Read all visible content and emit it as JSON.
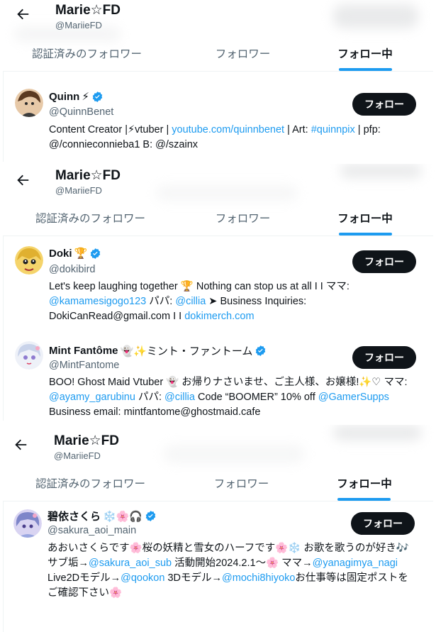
{
  "profile": {
    "name": "Marie☆FD",
    "handle": "@MariieFD"
  },
  "tabs": [
    "認証済みのフォロワー",
    "フォロワー",
    "フォロー中"
  ],
  "follow_label": "フォロー",
  "colors": {
    "accent": "#1d9bf0",
    "text": "#0f1419",
    "muted": "#536471",
    "button": "#0f1419"
  },
  "icons": {
    "back": "arrow-left-icon",
    "verified": "verified-badge-icon"
  },
  "users": [
    {
      "name": "Quinn",
      "emoji": "⚡",
      "handle": "@QuinnBenet",
      "bio": [
        {
          "t": "Content Creator |⚡vtuber | "
        },
        {
          "t": "youtube.com/quinnbenet",
          "link": true
        },
        {
          "t": " | Art: "
        },
        {
          "t": "#quinnpix",
          "link": true
        },
        {
          "t": " | pfp: @/connieconnieba1 B: @/szainx"
        }
      ]
    },
    {
      "name": "Doki",
      "emoji": "🏆",
      "handle": "@dokibird",
      "bio": [
        {
          "t": "Let's keep laughing together 🏆 Nothing can stop us at all I I ママ: "
        },
        {
          "t": "@kamamesigogo123",
          "link": true
        },
        {
          "t": " パパ: "
        },
        {
          "t": "@cillia",
          "link": true
        },
        {
          "t": " ➤ Business Inquiries: DokiCanRead@gmail.com I I "
        },
        {
          "t": "dokimerch.com",
          "link": true
        }
      ]
    },
    {
      "name": "Mint Fantôme",
      "emoji": "👻✨ミント・ファントーム",
      "handle": "@MintFantome",
      "bio": [
        {
          "t": "BOO! Ghost Maid Vtuber 👻 お帰りナさいませ、ご主人様、お嬢様!✨♡ ママ: "
        },
        {
          "t": "@ayamy_garubinu",
          "link": true
        },
        {
          "t": " パパ: "
        },
        {
          "t": "@cillia",
          "link": true
        },
        {
          "t": " Code “BOOMER” 10% off "
        },
        {
          "t": "@GamerSupps",
          "link": true
        },
        {
          "t": " Business email: mintfantome@ghostmaid.cafe"
        }
      ]
    },
    {
      "name": "碧依さくら",
      "emoji": "❄️🌸🎧",
      "handle": "@sakura_aoi_main",
      "bio": [
        {
          "t": "あおいさくらです🌸桜の妖精と雪女のハーフです🌸❄️ お歌を歌うのが好き🎶サブ垢→"
        },
        {
          "t": "@sakura_aoi_sub",
          "link": true
        },
        {
          "t": " 活動開始2024.2.1～🌸 ママ→"
        },
        {
          "t": "@yanagimya_nagi",
          "link": true
        },
        {
          "t": " Live2Dモデル→"
        },
        {
          "t": "@qookon",
          "link": true
        },
        {
          "t": " 3Dモデル→"
        },
        {
          "t": "@mochi8hiyoko",
          "link": true
        },
        {
          "t": "お仕事等は固定ポストをご確認下さい🌸"
        }
      ]
    }
  ]
}
